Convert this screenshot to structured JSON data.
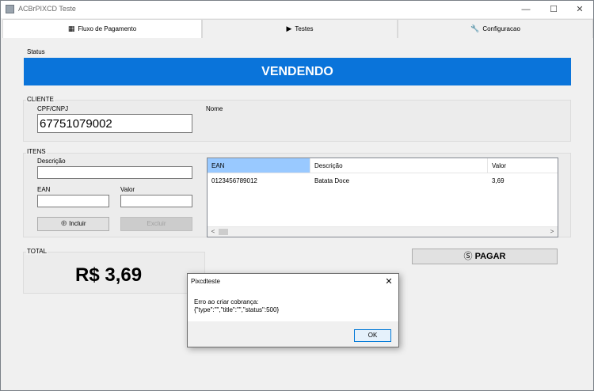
{
  "window": {
    "title": "ACBrPIXCD Teste",
    "minimize_glyph": "—",
    "maximize_glyph": "☐",
    "close_glyph": "✕"
  },
  "tabs": [
    {
      "label": "Fluxo de Pagamento",
      "icon": "qr-code-icon",
      "glyph": "▦",
      "active": true
    },
    {
      "label": "Testes",
      "icon": "play-icon",
      "glyph": "▶",
      "active": false
    },
    {
      "label": "Configuracao",
      "icon": "wrench-icon",
      "glyph": "🔧",
      "active": false
    }
  ],
  "status": {
    "label": "Status",
    "value": "VENDENDO",
    "color": "#0a74da"
  },
  "cliente": {
    "group_label": "CLIENTE",
    "cpf_label": "CPF/CNPJ",
    "cpf_value": "67751079002",
    "nome_label": "Nome"
  },
  "itens": {
    "group_label": "ITENS",
    "descricao_label": "Descrição",
    "descricao_value": "",
    "ean_label": "EAN",
    "ean_value": "",
    "valor_label": "Valor",
    "valor_value": "",
    "incluir_label": "Incluir",
    "incluir_glyph": "⊕",
    "excluir_label": "Excluir"
  },
  "grid": {
    "columns": [
      "EAN",
      "Descrição",
      "Valor"
    ],
    "rows": [
      [
        "0123456789012",
        "Batata Doce",
        "3,69"
      ]
    ],
    "scroll_left": "<",
    "scroll_right": ">"
  },
  "total": {
    "label": "TOTAL",
    "value": "R$ 3,69"
  },
  "pagar": {
    "label": "PAGAR",
    "glyph": "Ⓢ"
  },
  "dialog": {
    "title": "Pixcdteste",
    "close_glyph": "✕",
    "message_line1": "Erro ao criar cobrança:",
    "message_line2": "{\"type\":\"\",\"title\":\"\",\"status\":500}",
    "ok_label": "OK"
  }
}
